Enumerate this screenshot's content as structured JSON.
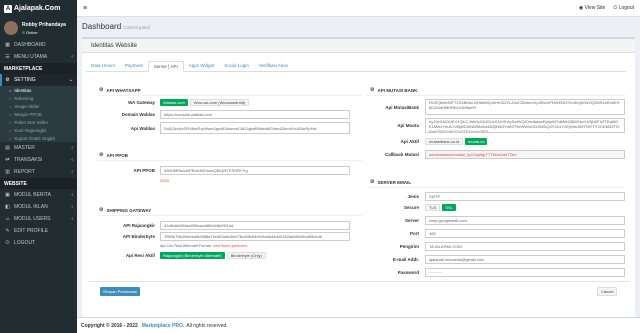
{
  "brand": {
    "name": "Ajalapak.Com",
    "box": "A"
  },
  "user": {
    "name": "Robby Prihandaya",
    "status": "Online"
  },
  "menu": {
    "dashboard": "DASHBOARD",
    "menu_utama": "MENU UTAMA",
    "marketplace": "MARKETPLACE",
    "setting": "SETTING",
    "sub": [
      "Identitas",
      "Rekening",
      "Image Slider",
      "Margin PPOB",
      "Paket Star Seller",
      "Kurir Rajaongkir",
      "Kupon Gratis Ongkir"
    ],
    "master": "MASTER",
    "transaksi": "TRANSAKSI",
    "report": "REPORT",
    "website": "WEBSITE",
    "modul_berita": "MODUL BERITA",
    "modul iklan": "MODUL IKLAN",
    "modul_users": "MODUL USERS",
    "edit_profile": "EDIT PROFILE",
    "logout": "LOGOUT"
  },
  "topbar": {
    "view_site": "View Site",
    "logout": "Logout"
  },
  "page": {
    "title": "Dashboard",
    "subtitle": "Control panel",
    "box_title": "Identitas Website"
  },
  "tabs": [
    "Data Umum",
    "Payment",
    "Server | API",
    "Apps Widget",
    "Social Login",
    "Verifikasi Akun"
  ],
  "wa": {
    "section": "API WHATSAPP",
    "gateway_label": "WA Gateway",
    "btn1": "Wablas.com",
    "btn2": "Woo-wa.com (Woowandroid)",
    "domain_label": "Domain Wablas",
    "domain_value": "https://console.wablas.com",
    "api_label": "Api Wablas",
    "api_value": "SoEj2zeAvDRVfksFhpWwmJgcs82ziwnmCADJgkaRMahdkGhmoZ6eohXsVDkrRpHw"
  },
  "ppob": {
    "section": "API PPOB",
    "label": "API PPOB",
    "value": "39KHMRaAJkPRoKiKEIooeQEiQRY97ElFE7rg",
    "note": "2093"
  },
  "ship": {
    "section": "SHIPPING GATEWAY",
    "rajaongkir_label": "API Rajaongkir",
    "rajaongkir_value": "42d5c6e554aa809caa4d6b2e8d9f11dd",
    "binderbyte_label": "API Binderbyte",
    "binderbyte_value": "7f5f9b7f8c99eeba5b55f8a7bc963e6c08e73bc8fbd0b0e5aded4d90182b6d69d5ea59dcdb",
    "note_prefix": "Api Cek Resi Alternatif Format : ",
    "note_red": "/resi?kurir=jne&resi=",
    "resi_label": "Api Resi Aktif",
    "resi_btn1": "Rajaongkir (Binderbyte Alternatif)",
    "resi_btn2": "Binderbyte (Only)"
  },
  "mutasi": {
    "section": "API MUTASI BANK",
    "bank_label": "Api MutasiBank",
    "bank_value": "RUSQkMvNiT7ZXidfk3wJ2HsbWQJnHKZl2VLZmZ2ZtdlcmVpZBUUFNWENOSXdhUjhGaVQ2MS1sR4hEH6DZmdHMHRfcUObNkeFf",
    "moota_label": "Api Moota",
    "moota_value": "eyJ0eXAiOiJKV1QiLCJhbGciOiJSUzI1NiJ9.eyJhdWQiOiIxIiwianRpIjoiNTdkMzQ5MGIwYzRjN2FhZTEwNGE1MzIxYmJkYzBjMDI5NWMwNzk5ZjlhNDYwNTRmNWIxODJiMDQ4Y2UzY2EyNmJlMTNlYTY2ODM3ZTI0NmE3NTUzNTQyZTE4YmIzZjE0",
    "aktif_label": "Api Aktif",
    "aktif_btn1": "mutasibank.co.id",
    "aktif_btn2": "moota.co",
    "callback_label": "Callback Mutasi",
    "callback_value": "administrator/mutasi_tyJOIgrflgrTTTbbaOobTZbe"
  },
  "email": {
    "section": "SERVER EMAIL",
    "jenis_label": "Jenis",
    "jenis_value": "SMTP",
    "secure_label": "Secure",
    "tls": "TLS",
    "ssl": "SSL",
    "server_label": "Server",
    "server_value": "smtp.googlemail.com",
    "port_label": "Port",
    "port_value": "465",
    "pengirim_label": "Pengirim",
    "pengirim_value": "TA.IALAPAK.COM",
    "email_label": "E-mail Addr.",
    "email_value": "ajalapak.indonesia@gmail.com",
    "password_label": "Password",
    "password_value": "··········"
  },
  "buttons": {
    "save": "Simpan Perubahan",
    "cancel": "Cancel"
  },
  "footer": {
    "copyright": "Copyright © 2016 - 2022",
    "brand": "Marketplace PRO.",
    "rights": "All rights reserved."
  }
}
